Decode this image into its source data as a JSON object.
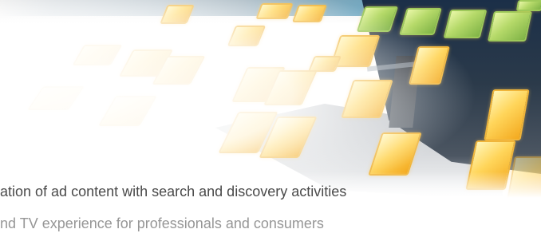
{
  "caption": {
    "line1": "ation of ad content with search and discovery activities",
    "line2": "nd TV experience for professionals and consumers"
  },
  "colors": {
    "tile_yellow": "#ffd55a",
    "tile_green": "#b5d969",
    "device_dark": "#2b3a4a",
    "top_accent": "#2882b4",
    "text": "#4a4a4a"
  }
}
